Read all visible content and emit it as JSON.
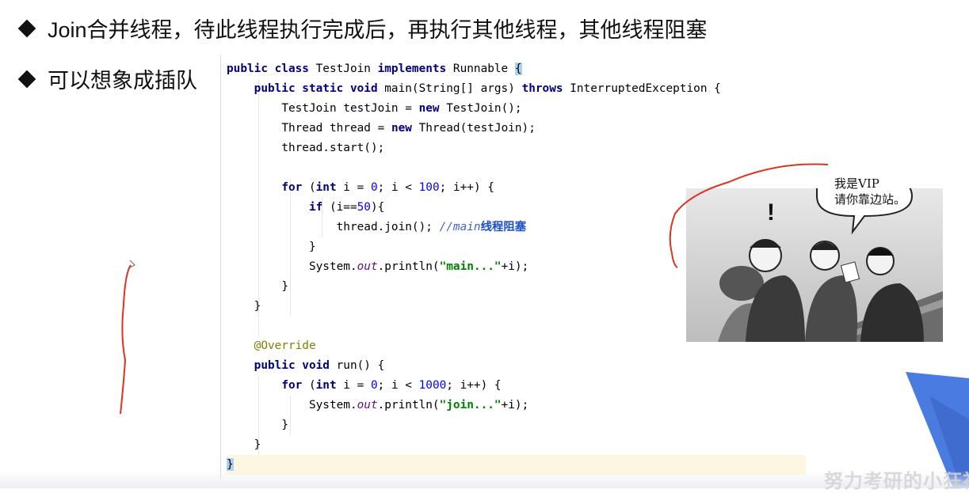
{
  "slide": {
    "bullets": [
      "Join合并线程，待此线程执行完成后，再执行其他线程，其他线程阻塞",
      "可以想象成插队"
    ]
  },
  "code": {
    "l1": [
      "public class",
      " TestJoin ",
      "implements",
      " Runnable ",
      "{"
    ],
    "l2": [
      "public static void",
      " main(String[] args) ",
      "throws",
      " InterruptedException {"
    ],
    "l3": [
      "TestJoin testJoin = ",
      "new",
      " TestJoin();"
    ],
    "l4": [
      "Thread thread = ",
      "new",
      " Thread(testJoin);"
    ],
    "l5": [
      "thread.start();"
    ],
    "l7": [
      "for",
      " (",
      "int",
      " i = ",
      "0",
      "; i < ",
      "100",
      "; i++) {"
    ],
    "l8": [
      "if",
      " (i==",
      "50",
      "){"
    ],
    "l9": [
      "thread.join(); ",
      "//main",
      "线程阻塞"
    ],
    "l10": [
      "}"
    ],
    "l11": [
      "System.",
      "out",
      ".println(",
      "\"main...\"",
      "+i);"
    ],
    "l12": [
      "}"
    ],
    "l13": [
      "}"
    ],
    "l15": [
      "@Override"
    ],
    "l16": [
      "public void",
      " run() {"
    ],
    "l17": [
      "for",
      " (",
      "int",
      " i = ",
      "0",
      "; i < ",
      "1000",
      "; i++) {"
    ],
    "l18": [
      "System.",
      "out",
      ".println(",
      "\"join...\"",
      "+i);"
    ],
    "l19": [
      "}"
    ],
    "l20": [
      "}"
    ],
    "l21": [
      "}"
    ]
  },
  "cartoon": {
    "speech_line1": "我是VIP",
    "speech_line2": "请你靠边站。",
    "exclaim": "!"
  },
  "watermark": "努力考研的小狂神",
  "colors": {
    "keyword": "#000080",
    "number": "#0000ff",
    "string": "#008000",
    "annotation": "#808000",
    "comment": "#3f60d6",
    "red_annotation": "#e0321e",
    "blue_shape": "#4a7be0"
  }
}
